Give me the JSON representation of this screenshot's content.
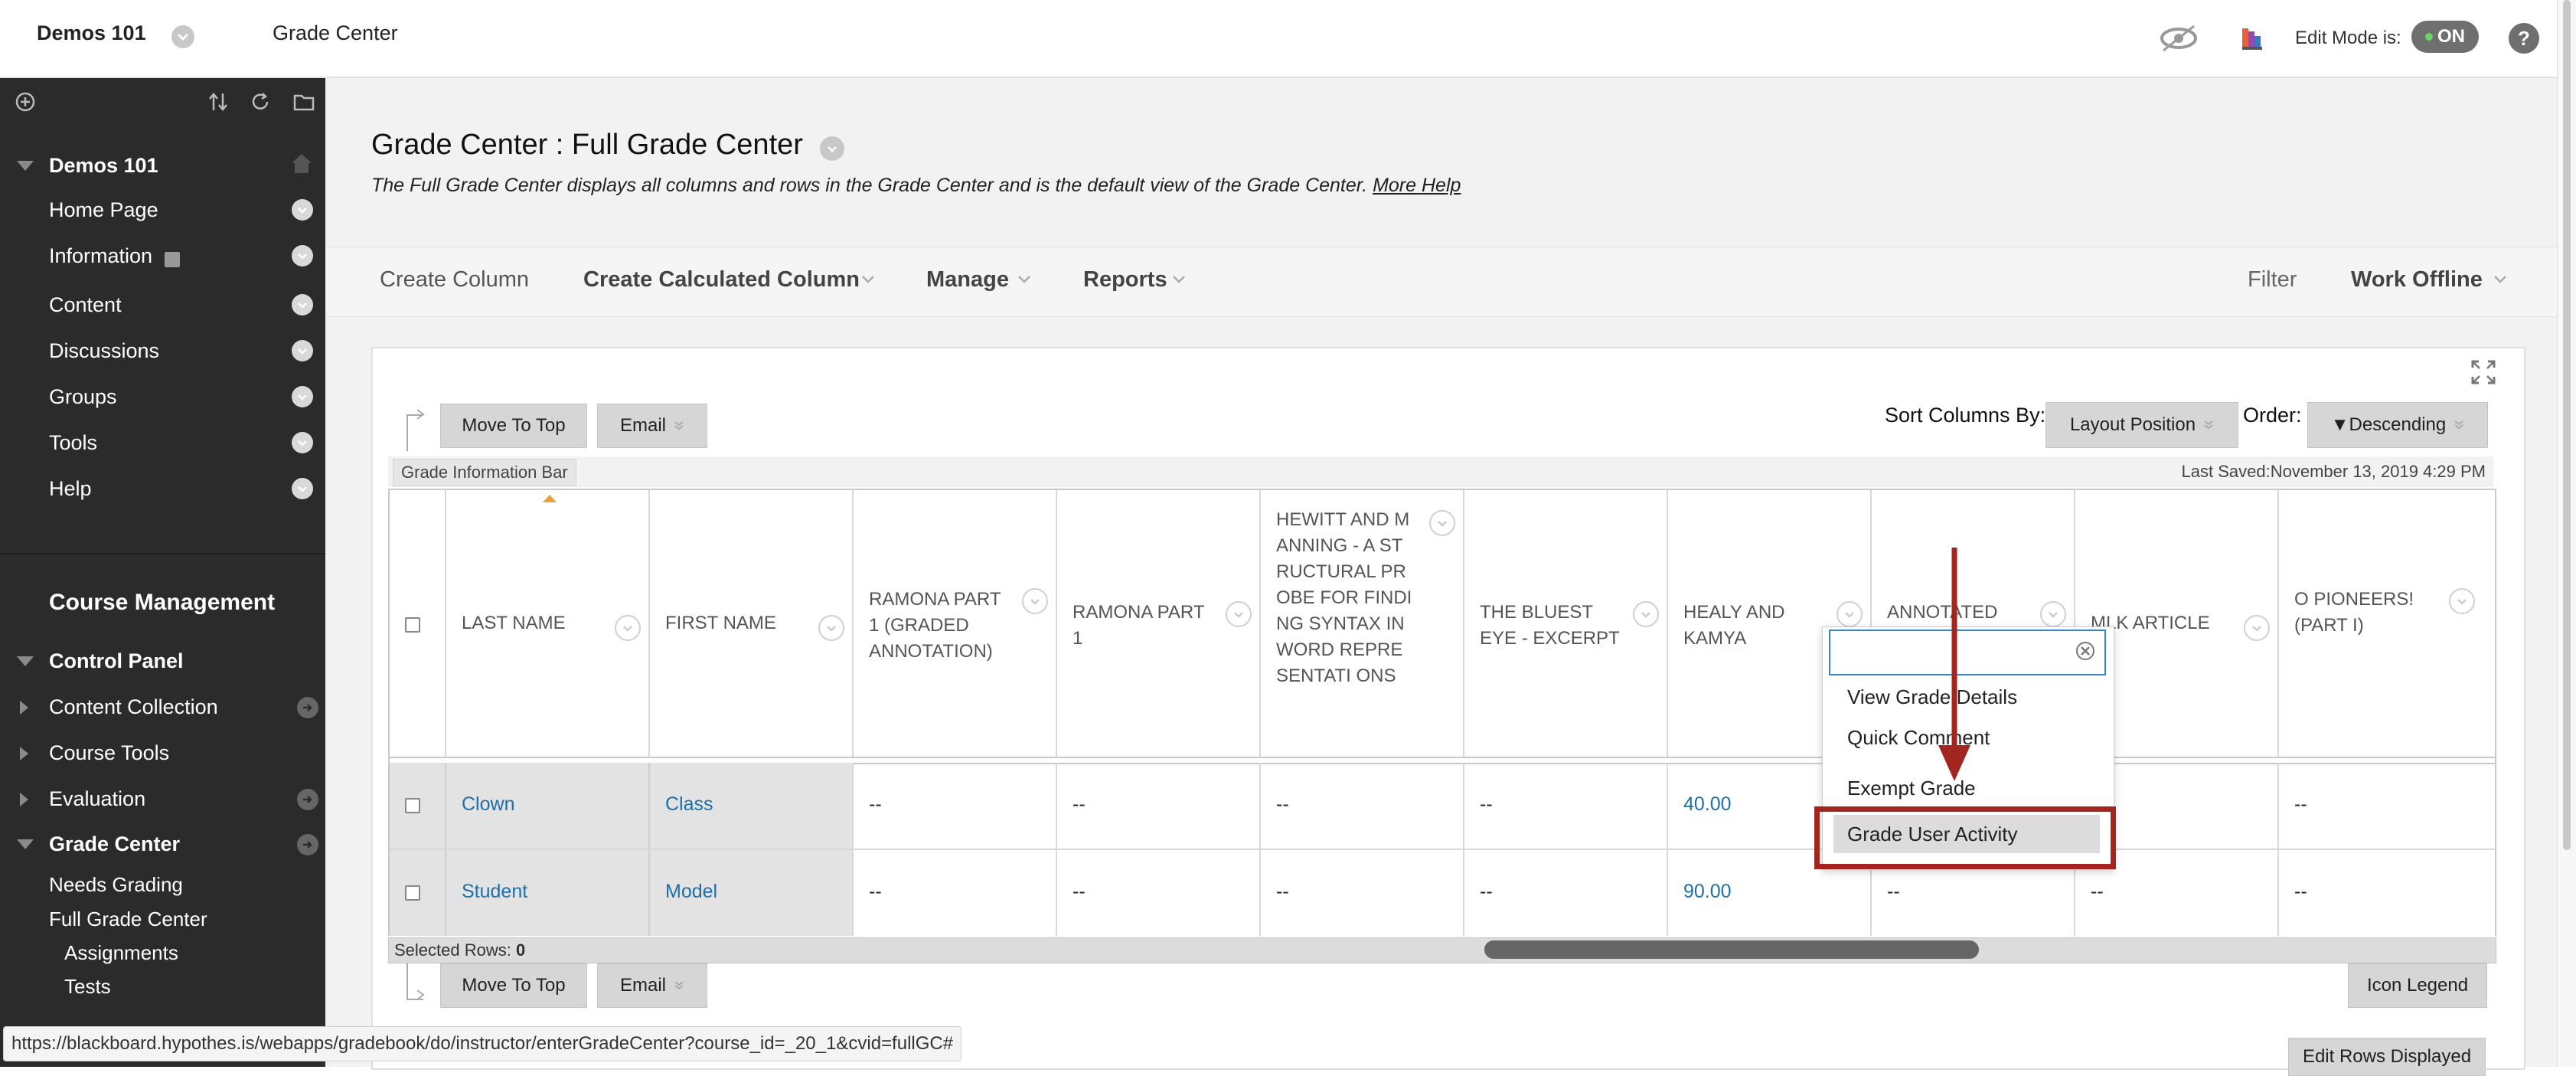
{
  "topbar": {
    "course_name": "Demos 101",
    "page_name": "Grade Center",
    "edit_mode_label": "Edit Mode is:",
    "edit_mode_value": "ON",
    "help_label": "?"
  },
  "sidebar": {
    "course_title": "Demos 101",
    "menu": [
      {
        "label": "Home Page"
      },
      {
        "label": "Information"
      },
      {
        "label": "Content"
      },
      {
        "label": "Discussions"
      },
      {
        "label": "Groups"
      },
      {
        "label": "Tools"
      },
      {
        "label": "Help"
      }
    ],
    "course_management": "Course Management",
    "control_panel": "Control Panel",
    "cp_items": [
      {
        "label": "Content Collection"
      },
      {
        "label": "Course Tools"
      },
      {
        "label": "Evaluation"
      },
      {
        "label": "Grade Center"
      }
    ],
    "gc_sub": [
      {
        "label": "Needs Grading"
      },
      {
        "label": "Full Grade Center"
      },
      {
        "label": "Assignments"
      },
      {
        "label": "Tests"
      }
    ]
  },
  "page": {
    "title": "Grade Center : Full Grade Center",
    "description": "The Full Grade Center displays all columns and rows in the Grade Center and is the default view of the Grade Center.",
    "more_help": "More Help"
  },
  "actions": {
    "create_column": "Create Column",
    "create_calculated_column": "Create Calculated Column",
    "manage": "Manage",
    "reports": "Reports",
    "filter": "Filter",
    "work_offline": "Work Offline"
  },
  "grid": {
    "move_to_top": "Move To Top",
    "email": "Email",
    "sort_by_label": "Sort Columns By:",
    "sort_by_value": "Layout Position",
    "order_label": "Order:",
    "order_value": "▼Descending",
    "info_bar": "Grade Information Bar",
    "last_saved": "Last Saved:November 13, 2019 4:29 PM",
    "columns": [
      "LAST NAME",
      "FIRST NAME",
      "RAMONA PART 1 (GRADED ANNOTATION)",
      "RAMONA PART 1",
      "HEWITT AND MANNING - A STRUCTURAL PROBE FOR FINDING SYNTAX IN WORD REPRESENTATI ONS",
      "THE BLUEST EYE - EXCERPT",
      "HEALY AND KAMYA",
      "ANNOTATED",
      "MLK ARTICLE",
      "O PIONEERS! (PART I)"
    ],
    "rows": [
      {
        "last": "Clown",
        "first": "Class",
        "cells": [
          "--",
          "--",
          "--",
          "--",
          "40.00",
          "",
          "",
          "--"
        ]
      },
      {
        "last": "Student",
        "first": "Model",
        "cells": [
          "--",
          "--",
          "--",
          "--",
          "90.00",
          "--",
          "--",
          "--"
        ]
      }
    ],
    "selected_rows_label": "Selected Rows:",
    "selected_rows_count": "0",
    "icon_legend": "Icon Legend",
    "edit_rows_displayed": "Edit Rows Displayed"
  },
  "context_menu": {
    "search_value": "",
    "items": [
      "View Grade Details",
      "Quick Comment",
      "Exempt Grade",
      "Grade User Activity"
    ],
    "highlighted_item": "Grade User Activity"
  },
  "status_url": "https://blackboard.hypothes.is/webapps/gradebook/do/instructor/enterGradeCenter?course_id=_20_1&cvid=fullGC#",
  "colors": {
    "annotation_red": "#a32520",
    "sidebar_bg": "#2b2b2b",
    "link_blue": "#1f6fa8"
  },
  "icons": [
    "chevron-down-icon",
    "preview-eye-icon",
    "color-palette-icon",
    "help-icon",
    "add-icon",
    "reorder-icon",
    "refresh-icon",
    "folder-icon",
    "home-icon",
    "arrow-right-icon",
    "expand-icon",
    "clear-icon"
  ]
}
